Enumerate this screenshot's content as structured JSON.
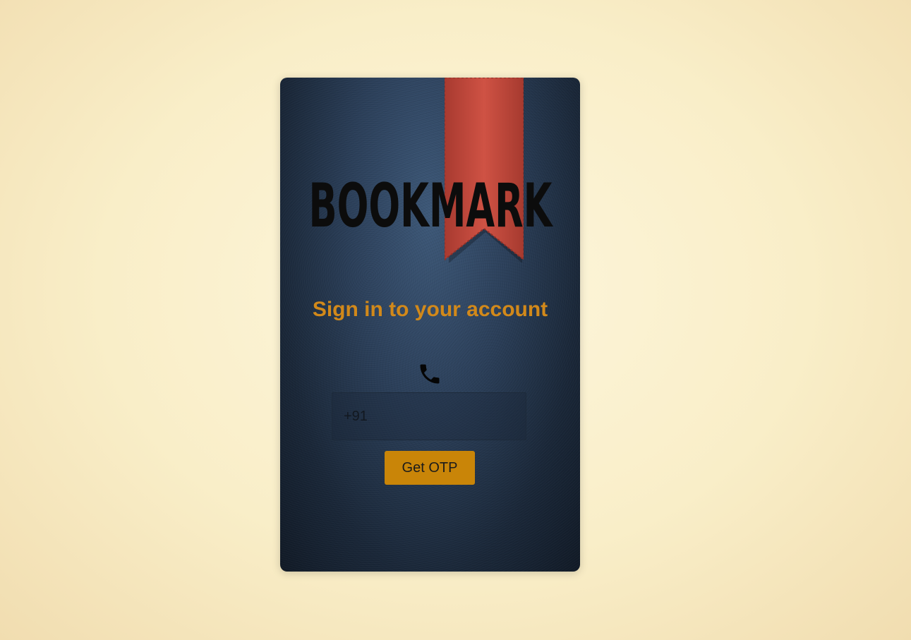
{
  "brand": {
    "logo_text": "BOOKMARK"
  },
  "signin": {
    "title": "Sign in to your account",
    "phone_icon": "phone-icon",
    "phone_placeholder": "+91",
    "get_otp_label": "Get OTP"
  },
  "colors": {
    "accent": "#d2891a",
    "button": "#c98508",
    "card": "#2b3f59",
    "ribbon": "#c0473a",
    "background": "#f9eec8"
  }
}
